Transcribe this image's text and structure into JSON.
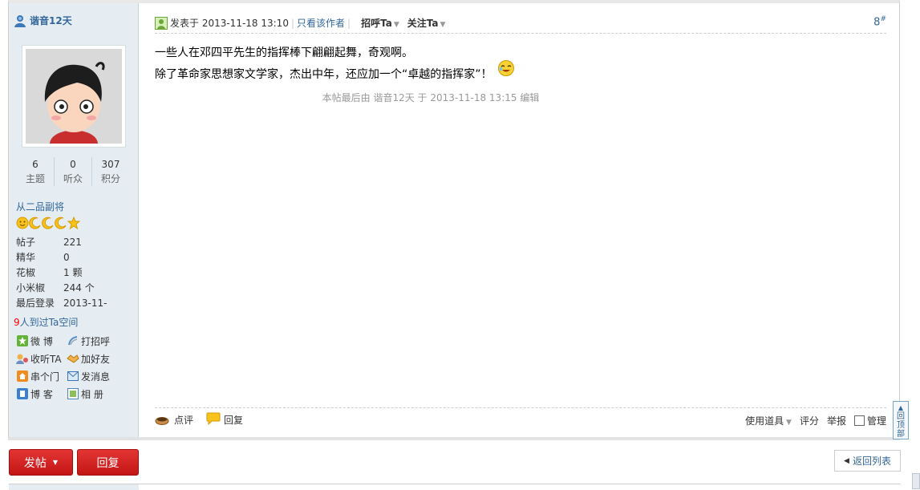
{
  "author": {
    "name": "谐音12天",
    "stats": [
      {
        "value": "6",
        "label": "主题"
      },
      {
        "value": "0",
        "label": "听众"
      },
      {
        "value": "307",
        "label": "积分"
      }
    ],
    "rank": "从二品副将",
    "profile": [
      {
        "key": "帖子",
        "value": "221"
      },
      {
        "key": "精华",
        "value": "0"
      },
      {
        "key": "花椒",
        "value": "1 颗"
      },
      {
        "key": "小米椒",
        "value": "244 个"
      },
      {
        "key": "最后登录",
        "value": "2013-11-"
      }
    ],
    "visits_count": "9",
    "visits_text": "人到过Ta空间",
    "actions": [
      {
        "label": "微 博",
        "icon": "weibo-icon"
      },
      {
        "label": "打招呼",
        "icon": "wave-icon"
      },
      {
        "label": "收听TA",
        "icon": "listen-icon"
      },
      {
        "label": "加好友",
        "icon": "handshake-icon"
      },
      {
        "label": "串个门",
        "icon": "home-icon"
      },
      {
        "label": "发消息",
        "icon": "mail-icon"
      },
      {
        "label": "博 客",
        "icon": "blog-icon"
      },
      {
        "label": "相 册",
        "icon": "album-icon"
      }
    ]
  },
  "post": {
    "posted_label": "发表于 2013-11-18 13:10",
    "only_author": "只看该作者",
    "greet": "招呼Ta",
    "follow": "关注Ta",
    "floor": "8",
    "floor_sup": "#",
    "line1": "一些人在邓四平先生的指挥棒下翩翩起舞，奇观啊。",
    "line2": "除了革命家思想家文学家，杰出中年，还应加一个“卓越的指挥家”！",
    "edit_note": "本帖最后由 谐音12天 于 2013-11-18 13:15 编辑"
  },
  "footer": {
    "comment": "点评",
    "reply": "回复",
    "tools": "使用道具",
    "rate": "评分",
    "report": "举报",
    "manage": "管理"
  },
  "back_top": "回顶部",
  "buttons": {
    "new_post": "发帖",
    "reply": "回复",
    "back_list": "返回列表"
  },
  "colors": {
    "link": "#336699",
    "sidebar_bg": "#e5edf2",
    "button_red": "#d42424"
  }
}
